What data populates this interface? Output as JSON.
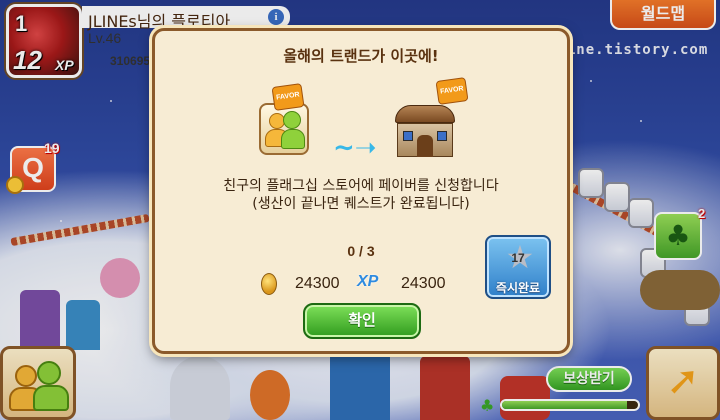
{
  "profile": {
    "level_badge": "12",
    "small_num": "1",
    "xp_label": "XP",
    "name": "JLINEs님의 플로티아",
    "level": "Lv.46",
    "xp_value": "310695"
  },
  "topbar": {
    "worldmap_label": "월드맵",
    "watermark": "jline.tistory.com"
  },
  "side": {
    "quest_label": "Q",
    "quest_badge": "19",
    "clover_badge": "2"
  },
  "bottom": {
    "reward_label": "보상받기",
    "progress_fraction": 0.92
  },
  "dialog": {
    "title": "올해의 트랜드가 이곳에!",
    "description_line1": "친구의 플래그십 스토어에 페이버를 신청합니다",
    "description_line2": "(생산이 끝나면 퀘스트가 완료됩니다)",
    "progress": "0 / 3",
    "coin_reward": "24300",
    "xp_reward": "24300",
    "xp_tag": "XP",
    "instant_count": "17",
    "instant_label": "즉시완료",
    "confirm_label": "확인",
    "badge_text": "FAVOR"
  },
  "colors": {
    "dialog_bg": "#f7ecd4",
    "dialog_border": "#8b5a2b",
    "confirm": "#36a224",
    "worldmap": "#e8601f"
  }
}
